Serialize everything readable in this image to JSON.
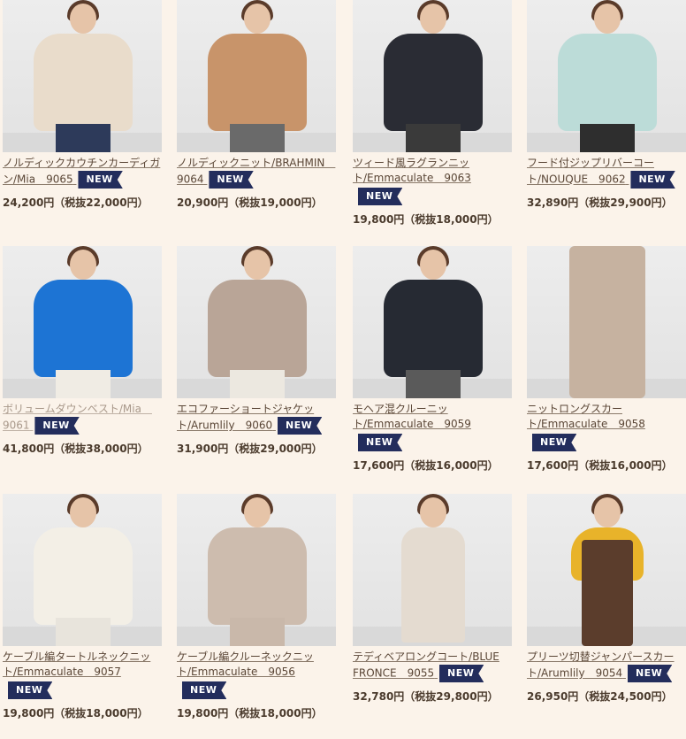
{
  "badge_label": "NEW",
  "products": [
    {
      "title_a": "ノルディックカウチンカーディガ",
      "title_b": "ン/Mia　9065",
      "price": "24,200円（税抜22,000円）",
      "garment_color": "#e9dccb"
    },
    {
      "title_a": "ノルディックニット/BRAHMIN　",
      "title_b": "9064",
      "price": "20,900円（税抜19,000円）",
      "garment_color": "#c8946a"
    },
    {
      "title_a": "ツィード風ラグランニッ",
      "title_b": "ト/Emmaculate　9063",
      "price": "19,800円（税抜18,000円）",
      "garment_color": "#2a2c34"
    },
    {
      "title_a": "フード付ジップリバーコー",
      "title_b": "ト/NOUQUE　9062",
      "price": "32,890円（税抜29,900円）",
      "garment_color": "#bcdcd8"
    },
    {
      "title_a": "ボリュームダウンベスト/Mia　",
      "title_b": "9061",
      "price": "41,800円（税抜38,000円）",
      "garment_color": "#1d74d4"
    },
    {
      "title_a": "エコファーショートジャケッ",
      "title_b": "ト/Arumlily　9060",
      "price": "31,900円（税抜29,000円）",
      "garment_color": "#b9a597"
    },
    {
      "title_a": "モヘア混クルーニッ",
      "title_b": "ト/Emmaculate　9059",
      "price": "17,600円（税抜16,000円）",
      "garment_color": "#262a33"
    },
    {
      "title_a": "ニットロングスカー",
      "title_b": "ト/Emmaculate　9058",
      "price": "17,600円（税抜16,000円）",
      "garment_color": "#c6b2a0"
    },
    {
      "title_a": "ケーブル編タートルネックニッ",
      "title_b": "ト/Emmaculate　9057",
      "price": "19,800円（税抜18,000円）",
      "garment_color": "#f3efe6"
    },
    {
      "title_a": "ケーブル編クルーネックニッ",
      "title_b": "ト/Emmaculate　9056",
      "price": "19,800円（税抜18,000円）",
      "garment_color": "#cdbcae"
    },
    {
      "title_a": "テディベアロングコート/BLUE",
      "title_b": "FRONCE　9055",
      "price": "32,780円（税抜29,800円）",
      "garment_color": "#e4dbd0"
    },
    {
      "title_a": "プリーツ切替ジャンパースカー",
      "title_b": "ト/Arumlily　9054",
      "price": "26,950円（税抜24,500円）",
      "garment_color": "#5b3d2c"
    }
  ]
}
